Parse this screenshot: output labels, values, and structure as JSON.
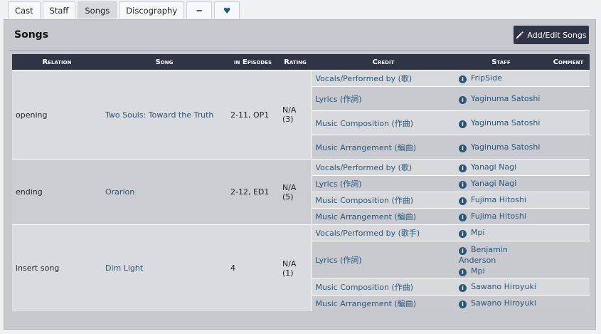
{
  "tabs": [
    "Cast",
    "Staff",
    "Songs",
    "Discography"
  ],
  "panel_title": "Songs",
  "edit_button": "Add/Edit Songs",
  "columns": [
    "Relation",
    "Song",
    "in Episodes",
    "Rating",
    "Credit",
    "Staff",
    "Comment"
  ],
  "songs": [
    {
      "relation": "opening",
      "title": "Two Souls: Toward the Truth",
      "episodes": "2-11, OP1",
      "rating": "N/A",
      "votes": "(3)",
      "credits": [
        {
          "role": "Vocals/Performed by (歌)",
          "staff": [
            "FripSide"
          ]
        },
        {
          "role": "Lyrics (作詞)",
          "staff": [
            "Yaginuma Satoshi"
          ]
        },
        {
          "role": "Music Composition (作曲)",
          "staff": [
            "Yaginuma Satoshi"
          ]
        },
        {
          "role": "Music Arrangement (編曲)",
          "staff": [
            "Yaginuma Satoshi"
          ]
        }
      ]
    },
    {
      "relation": "ending",
      "title": "Orarion",
      "episodes": "2-12, ED1",
      "rating": "N/A",
      "votes": "(5)",
      "credits": [
        {
          "role": "Vocals/Performed by (歌)",
          "staff": [
            "Yanagi Nagi"
          ]
        },
        {
          "role": "Lyrics (作詞)",
          "staff": [
            "Yanagi Nagi"
          ]
        },
        {
          "role": "Music Composition (作曲)",
          "staff": [
            "Fujima Hitoshi"
          ]
        },
        {
          "role": "Music Arrangement (編曲)",
          "staff": [
            "Fujima Hitoshi"
          ]
        }
      ]
    },
    {
      "relation": "insert song",
      "title": "Dim Light",
      "episodes": "4",
      "rating": "N/A",
      "votes": "(1)",
      "credits": [
        {
          "role": "Vocals/Performed by (歌手)",
          "staff": [
            "Mpi"
          ]
        },
        {
          "role": "Lyrics (作詞)",
          "staff": [
            "Benjamin Anderson",
            "Mpi"
          ]
        },
        {
          "role": "Music Composition (作曲)",
          "staff": [
            "Sawano Hiroyuki"
          ]
        },
        {
          "role": "Music Arrangement (編曲)",
          "staff": [
            "Sawano Hiroyuki"
          ]
        }
      ]
    }
  ]
}
